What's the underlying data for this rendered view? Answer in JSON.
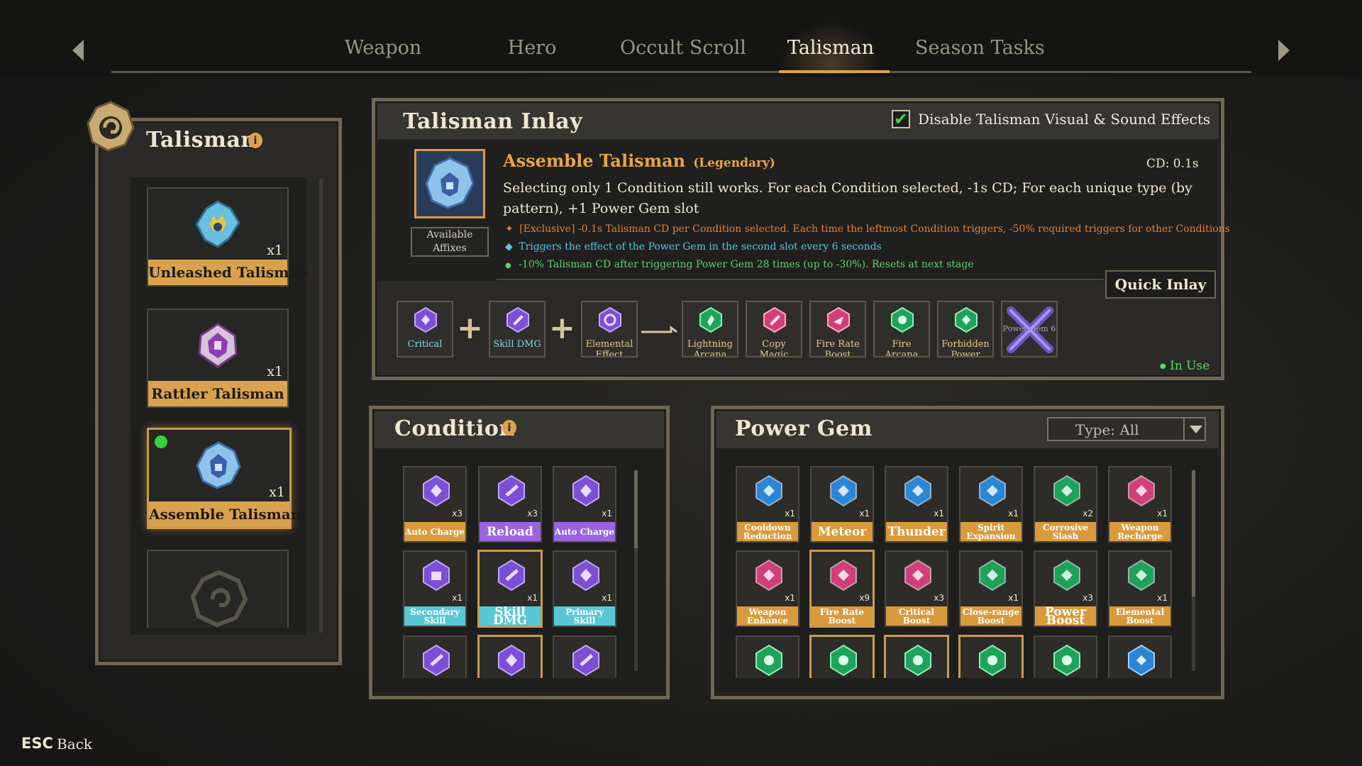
{
  "tabs": [
    {
      "label": "Weapon"
    },
    {
      "label": "Hero"
    },
    {
      "label": "Occult Scroll"
    },
    {
      "label": "Talisman"
    },
    {
      "label": "Season Tasks"
    }
  ],
  "active_tab": "Talisman",
  "talisman_panel": {
    "title": "Talisman",
    "items": [
      {
        "name": "Unleashed Talisman",
        "count": "x1"
      },
      {
        "name": "Rattler Talisman",
        "count": "x1"
      },
      {
        "name": "Assemble Talisman",
        "count": "x1",
        "equipped": true
      }
    ]
  },
  "inlay": {
    "title": "Talisman Inlay",
    "disable_effects_label": "Disable Talisman Visual & Sound Effects",
    "disable_effects_checked": true,
    "talisman_name": "Assemble Talisman",
    "rarity": "(Legendary)",
    "cd_label": "CD:",
    "cd_value": "0.1s",
    "description": "Selecting only 1 Condition still works. For each Condition selected, -1s CD; For each unique type (by pattern), +1 Power Gem slot",
    "available_affixes": "Available Affixes",
    "effects": [
      {
        "bullet": "✦",
        "text": "[Exclusive] -0.1s Talisman CD per Condition selected. Each time the leftmost Condition triggers, -50% required triggers for other Conditions",
        "color": "#e0803a"
      },
      {
        "bullet": "◆",
        "text": "Triggers the effect of the Power Gem in the second slot every 6 seconds",
        "color": "#5cc3e3"
      },
      {
        "bullet": "●",
        "text": "-10% Talisman CD after triggering Power Gem 28 times (up to -30%). Resets at next stage",
        "color": "#62d070"
      }
    ],
    "quick_inlay": "Quick Inlay",
    "conditions_slots": [
      {
        "label": "Critical",
        "color": "#7b4fd6"
      },
      {
        "label": "Skill DMG",
        "color": "#7b4fd6"
      },
      {
        "label": "Elemental Effect",
        "color": "#7b4fd6"
      }
    ],
    "gem_slots": [
      {
        "label": "Lightning Arcana",
        "color": "#1fa35a"
      },
      {
        "label": "Copy Magic",
        "color": "#d13f7a"
      },
      {
        "label": "Fire Rate Boost",
        "color": "#d13f7a"
      },
      {
        "label": "Fire Arcana",
        "color": "#1fa35a"
      },
      {
        "label": "Forbidden Power",
        "color": "#1fa35a"
      },
      {
        "label": "Power Gem 6",
        "color": "#6e55c9"
      }
    ],
    "in_use": "In Use"
  },
  "condition": {
    "title": "Condition",
    "items": [
      {
        "label": "Auto Charge",
        "count": "x3",
        "style": "orange"
      },
      {
        "label": "Reload",
        "count": "x3",
        "style": "purple"
      },
      {
        "label": "Auto Charge",
        "count": "x1",
        "style": "purple"
      },
      {
        "label": "Secondary Skill",
        "count": "x1",
        "style": "cyan"
      },
      {
        "label": "Skill DMG",
        "count": "x1",
        "style": "cyan"
      },
      {
        "label": "Primary Skill",
        "count": "x1",
        "style": "cyan"
      }
    ]
  },
  "power_gem": {
    "title": "Power Gem",
    "type_filter": "Type: All",
    "items": [
      {
        "label": "Cooldown Reduction",
        "count": "x1",
        "color": "#2b86d6"
      },
      {
        "label": "Meteor",
        "count": "x1",
        "color": "#2b86d6"
      },
      {
        "label": "Thunder",
        "count": "x1",
        "color": "#2b86d6"
      },
      {
        "label": "Spirit Expansion",
        "count": "x1",
        "color": "#2b86d6"
      },
      {
        "label": "Corrosive Slash",
        "count": "x2",
        "color": "#1fa35a"
      },
      {
        "label": "Weapon Recharge",
        "count": "x1",
        "color": "#d13f7a"
      },
      {
        "label": "Weapon Enhance",
        "count": "x1",
        "color": "#d13f7a"
      },
      {
        "label": "Fire Rate Boost",
        "count": "x9",
        "color": "#d13f7a"
      },
      {
        "label": "Critical Boost",
        "count": "x3",
        "color": "#d13f7a"
      },
      {
        "label": "Close-range Boost",
        "count": "x1",
        "color": "#1fa35a"
      },
      {
        "label": "Power Boost",
        "count": "x3",
        "color": "#1fa35a"
      },
      {
        "label": "Elemental Boost",
        "count": "x1",
        "color": "#1fa35a"
      }
    ]
  },
  "footer": {
    "esc": "ESC",
    "back": "Back"
  }
}
